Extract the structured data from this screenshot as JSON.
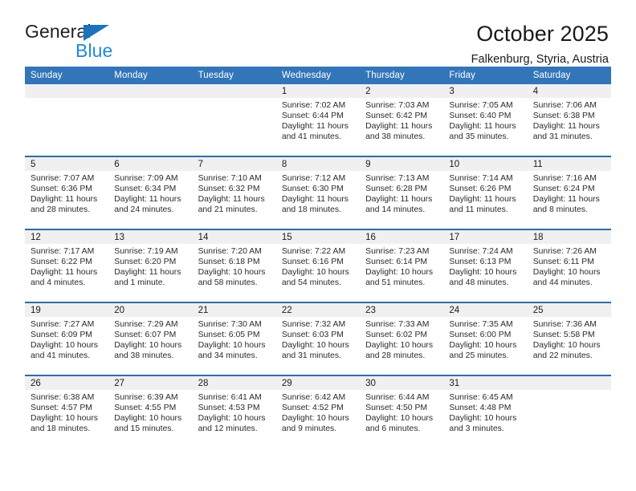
{
  "brand": {
    "name_top": "General",
    "name_bottom": "Blue",
    "triangle_color": "#1c72bb",
    "blue_color": "#2288d6"
  },
  "header": {
    "title": "October 2025",
    "subtitle": "Falkenburg, Styria, Austria"
  },
  "theme": {
    "header_blue": "#3275b8",
    "rule_blue": "#2e6da4",
    "daynum_band": "#f0f0f0"
  },
  "labels": {
    "sunrise_prefix": "Sunrise:",
    "sunset_prefix": "Sunset:",
    "daylight_prefix": "Daylight:"
  },
  "weekday_headers": [
    "Sunday",
    "Monday",
    "Tuesday",
    "Wednesday",
    "Thursday",
    "Friday",
    "Saturday"
  ],
  "weeks": [
    [
      {
        "day": ""
      },
      {
        "day": ""
      },
      {
        "day": ""
      },
      {
        "day": "1",
        "sunrise": "Sunrise: 7:02 AM",
        "sunset": "Sunset: 6:44 PM",
        "daylight": "Daylight: 11 hours and 41 minutes."
      },
      {
        "day": "2",
        "sunrise": "Sunrise: 7:03 AM",
        "sunset": "Sunset: 6:42 PM",
        "daylight": "Daylight: 11 hours and 38 minutes."
      },
      {
        "day": "3",
        "sunrise": "Sunrise: 7:05 AM",
        "sunset": "Sunset: 6:40 PM",
        "daylight": "Daylight: 11 hours and 35 minutes."
      },
      {
        "day": "4",
        "sunrise": "Sunrise: 7:06 AM",
        "sunset": "Sunset: 6:38 PM",
        "daylight": "Daylight: 11 hours and 31 minutes."
      }
    ],
    [
      {
        "day": "5",
        "sunrise": "Sunrise: 7:07 AM",
        "sunset": "Sunset: 6:36 PM",
        "daylight": "Daylight: 11 hours and 28 minutes."
      },
      {
        "day": "6",
        "sunrise": "Sunrise: 7:09 AM",
        "sunset": "Sunset: 6:34 PM",
        "daylight": "Daylight: 11 hours and 24 minutes."
      },
      {
        "day": "7",
        "sunrise": "Sunrise: 7:10 AM",
        "sunset": "Sunset: 6:32 PM",
        "daylight": "Daylight: 11 hours and 21 minutes."
      },
      {
        "day": "8",
        "sunrise": "Sunrise: 7:12 AM",
        "sunset": "Sunset: 6:30 PM",
        "daylight": "Daylight: 11 hours and 18 minutes."
      },
      {
        "day": "9",
        "sunrise": "Sunrise: 7:13 AM",
        "sunset": "Sunset: 6:28 PM",
        "daylight": "Daylight: 11 hours and 14 minutes."
      },
      {
        "day": "10",
        "sunrise": "Sunrise: 7:14 AM",
        "sunset": "Sunset: 6:26 PM",
        "daylight": "Daylight: 11 hours and 11 minutes."
      },
      {
        "day": "11",
        "sunrise": "Sunrise: 7:16 AM",
        "sunset": "Sunset: 6:24 PM",
        "daylight": "Daylight: 11 hours and 8 minutes."
      }
    ],
    [
      {
        "day": "12",
        "sunrise": "Sunrise: 7:17 AM",
        "sunset": "Sunset: 6:22 PM",
        "daylight": "Daylight: 11 hours and 4 minutes."
      },
      {
        "day": "13",
        "sunrise": "Sunrise: 7:19 AM",
        "sunset": "Sunset: 6:20 PM",
        "daylight": "Daylight: 11 hours and 1 minute."
      },
      {
        "day": "14",
        "sunrise": "Sunrise: 7:20 AM",
        "sunset": "Sunset: 6:18 PM",
        "daylight": "Daylight: 10 hours and 58 minutes."
      },
      {
        "day": "15",
        "sunrise": "Sunrise: 7:22 AM",
        "sunset": "Sunset: 6:16 PM",
        "daylight": "Daylight: 10 hours and 54 minutes."
      },
      {
        "day": "16",
        "sunrise": "Sunrise: 7:23 AM",
        "sunset": "Sunset: 6:14 PM",
        "daylight": "Daylight: 10 hours and 51 minutes."
      },
      {
        "day": "17",
        "sunrise": "Sunrise: 7:24 AM",
        "sunset": "Sunset: 6:13 PM",
        "daylight": "Daylight: 10 hours and 48 minutes."
      },
      {
        "day": "18",
        "sunrise": "Sunrise: 7:26 AM",
        "sunset": "Sunset: 6:11 PM",
        "daylight": "Daylight: 10 hours and 44 minutes."
      }
    ],
    [
      {
        "day": "19",
        "sunrise": "Sunrise: 7:27 AM",
        "sunset": "Sunset: 6:09 PM",
        "daylight": "Daylight: 10 hours and 41 minutes."
      },
      {
        "day": "20",
        "sunrise": "Sunrise: 7:29 AM",
        "sunset": "Sunset: 6:07 PM",
        "daylight": "Daylight: 10 hours and 38 minutes."
      },
      {
        "day": "21",
        "sunrise": "Sunrise: 7:30 AM",
        "sunset": "Sunset: 6:05 PM",
        "daylight": "Daylight: 10 hours and 34 minutes."
      },
      {
        "day": "22",
        "sunrise": "Sunrise: 7:32 AM",
        "sunset": "Sunset: 6:03 PM",
        "daylight": "Daylight: 10 hours and 31 minutes."
      },
      {
        "day": "23",
        "sunrise": "Sunrise: 7:33 AM",
        "sunset": "Sunset: 6:02 PM",
        "daylight": "Daylight: 10 hours and 28 minutes."
      },
      {
        "day": "24",
        "sunrise": "Sunrise: 7:35 AM",
        "sunset": "Sunset: 6:00 PM",
        "daylight": "Daylight: 10 hours and 25 minutes."
      },
      {
        "day": "25",
        "sunrise": "Sunrise: 7:36 AM",
        "sunset": "Sunset: 5:58 PM",
        "daylight": "Daylight: 10 hours and 22 minutes."
      }
    ],
    [
      {
        "day": "26",
        "sunrise": "Sunrise: 6:38 AM",
        "sunset": "Sunset: 4:57 PM",
        "daylight": "Daylight: 10 hours and 18 minutes."
      },
      {
        "day": "27",
        "sunrise": "Sunrise: 6:39 AM",
        "sunset": "Sunset: 4:55 PM",
        "daylight": "Daylight: 10 hours and 15 minutes."
      },
      {
        "day": "28",
        "sunrise": "Sunrise: 6:41 AM",
        "sunset": "Sunset: 4:53 PM",
        "daylight": "Daylight: 10 hours and 12 minutes."
      },
      {
        "day": "29",
        "sunrise": "Sunrise: 6:42 AM",
        "sunset": "Sunset: 4:52 PM",
        "daylight": "Daylight: 10 hours and 9 minutes."
      },
      {
        "day": "30",
        "sunrise": "Sunrise: 6:44 AM",
        "sunset": "Sunset: 4:50 PM",
        "daylight": "Daylight: 10 hours and 6 minutes."
      },
      {
        "day": "31",
        "sunrise": "Sunrise: 6:45 AM",
        "sunset": "Sunset: 4:48 PM",
        "daylight": "Daylight: 10 hours and 3 minutes."
      },
      {
        "day": ""
      }
    ]
  ]
}
